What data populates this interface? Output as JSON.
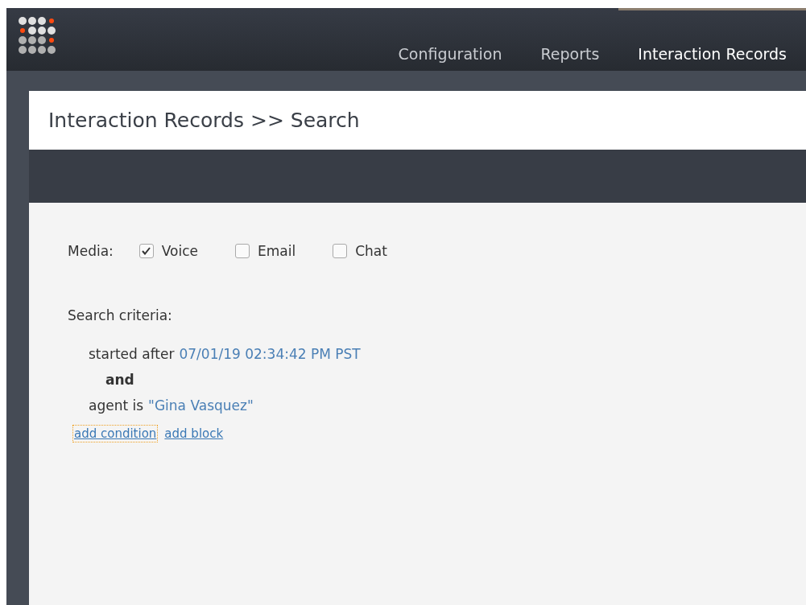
{
  "nav": {
    "tabs": [
      {
        "label": "Configuration",
        "selected": false
      },
      {
        "label": "Reports",
        "selected": false
      },
      {
        "label": "Interaction Records",
        "selected": true
      }
    ]
  },
  "page": {
    "title": "Interaction Records >> Search"
  },
  "media": {
    "label": "Media:",
    "options": [
      {
        "label": "Voice",
        "checked": true
      },
      {
        "label": "Email",
        "checked": false
      },
      {
        "label": "Chat",
        "checked": false
      }
    ]
  },
  "criteria": {
    "label": "Search criteria:",
    "conditions": [
      {
        "text": "started after",
        "value": "07/01/19 02:34:42 PM PST"
      },
      {
        "text": "agent is",
        "value": "\"Gina Vasquez\""
      }
    ],
    "joiner": "and",
    "links": [
      {
        "label": "add condition",
        "focused": true
      },
      {
        "label": "add block",
        "focused": false
      }
    ]
  }
}
